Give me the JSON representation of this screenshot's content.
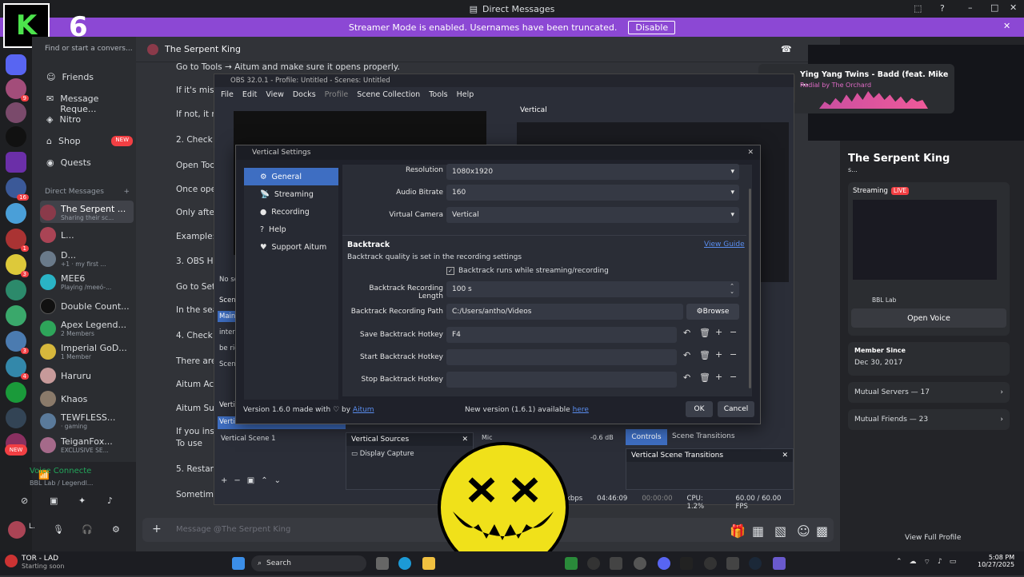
{
  "window": {
    "title": "Direct Messages"
  },
  "banner": {
    "text": "Streamer Mode is enabled. Usernames have been truncated.",
    "disable": "Disable"
  },
  "overlay": {
    "counter": "6"
  },
  "dm": {
    "search": "Find or start a convers...",
    "nav": [
      {
        "label": "Friends"
      },
      {
        "label": "Message Reque..."
      },
      {
        "label": "Nitro"
      },
      {
        "label": "Shop",
        "badge": "NEW"
      },
      {
        "label": "Quests"
      }
    ],
    "section": "Direct Messages",
    "items": [
      {
        "name": "The Serpent ...",
        "sub": "Sharing their sc..."
      },
      {
        "name": "L...",
        "sub": ""
      },
      {
        "name": "D...",
        "sub": "+1 · my first ..."
      },
      {
        "name": "MEE6",
        "sub": "Playing /meeó-..."
      },
      {
        "name": "Double Count...",
        "sub": ""
      },
      {
        "name": "Apex Legend...",
        "sub": "2 Members"
      },
      {
        "name": "Imperial GoD...",
        "sub": "1 Member"
      },
      {
        "name": "Haruru",
        "sub": ""
      },
      {
        "name": "Khaos",
        "sub": ""
      },
      {
        "name": "TEWFLESS...",
        "sub": "· gaming"
      },
      {
        "name": "TeiganFox...",
        "sub": "EXCLUSIVE SE..."
      }
    ],
    "voice": {
      "title": "Voice Connecte",
      "sub": "BBL Lab / Legendl..."
    },
    "user": {
      "name": "L."
    }
  },
  "chat": {
    "header": "The Serpent King",
    "placeholder": "Message @The Serpent King",
    "lines": [
      "Go to Tools → Aitum and make sure it opens properly.",
      "If it's missi",
      "If not, it mi",
      "2. Check th",
      "Open Tools",
      "Once open",
      "Only after",
      "Example: Y",
      "3. OBS Ho",
      "Go to Sett",
      "In the sear",
      "4. Check th",
      "There are",
      "Aitum Acti",
      "Aitum Suit",
      "If you insta",
      "To use",
      "5. Restart",
      "Sometime"
    ]
  },
  "obs": {
    "title": "OBS 32.0.1 - Profile: Untitled - Scenes: Untitled",
    "menu": [
      "File",
      "Edit",
      "View",
      "Docks",
      "Profile",
      "Scene Collection",
      "Tools",
      "Help"
    ],
    "vertical": "Vertical",
    "no_source": "No so",
    "scene_item": "Vertical Scene 1",
    "sources_title": "Vertical Sources",
    "source": "Display Capture",
    "mixer": {
      "label": "Mic",
      "db": "-0.6 dB"
    },
    "controls": "Controls",
    "scene_transitions": "Scene Transitions",
    "vst": "Vertical Scene Transitions",
    "status": {
      "kbps": "kbps",
      "time": "04:46:09",
      "rec": "00:00:00",
      "cpu": "CPU: 1.2%",
      "fps": "60.00 / 60.00 FPS"
    },
    "scn_head": "Scene",
    "main": "Main",
    "inte": "inter",
    "beri": "be rig",
    "scen": "Scen",
    "vert": "Verti",
    "vert2": "Verti"
  },
  "settings": {
    "title": "Vertical Settings",
    "nav": [
      {
        "label": "General",
        "icon": "⚙"
      },
      {
        "label": "Streaming",
        "icon": "📡"
      },
      {
        "label": "Recording",
        "icon": "●"
      },
      {
        "label": "Help",
        "icon": "?"
      },
      {
        "label": "Support Aitum",
        "icon": "♥"
      }
    ],
    "resolution": {
      "label": "Resolution",
      "value": "1080x1920"
    },
    "audio": {
      "label": "Audio Bitrate",
      "value": "160"
    },
    "vcam": {
      "label": "Virtual Camera",
      "value": "Vertical"
    },
    "backtrack": {
      "title": "Backtrack",
      "guide": "View Guide",
      "desc": "Backtrack quality is set in the recording settings",
      "checkbox": "Backtrack runs while streaming/recording",
      "length_label": "Backtrack Recording Length",
      "length": "100 s",
      "path_label": "Backtrack Recording Path",
      "path": "C:/Users/antho/Videos",
      "browse": "Browse",
      "save_label": "Save Backtrack Hotkey",
      "save": "F4",
      "start_label": "Start Backtrack Hotkey",
      "stop_label": "Stop Backtrack Hotkey"
    },
    "footer": {
      "version": "Version 1.6.0 made with ♡ by",
      "aitum": "Aitum",
      "newver": "New version (1.6.1) available",
      "here": "here",
      "ok": "OK",
      "cancel": "Cancel"
    }
  },
  "popup": {
    "song": "Ying Yang Twins - Badd (feat. Mike ...",
    "artist": "Radial by The Orchard"
  },
  "profile": {
    "name": "The Serpent King",
    "tag": "s...",
    "streaming": "Streaming",
    "live": "LIVE",
    "lab": "BBL Lab",
    "open_voice": "Open Voice",
    "member_label": "Member Since",
    "member": "Dec 30, 2017",
    "servers": "Mutual Servers — 17",
    "friends": "Mutual Friends — 23",
    "view": "View Full Profile"
  },
  "taskbar": {
    "weather_title": "TOR - LAD",
    "weather_sub": "Starting soon",
    "search": "Search",
    "time": "5:08 PM",
    "date": "10/27/2025"
  },
  "colors": {
    "accent": "#8c48d4",
    "live": "#f23f43",
    "obsblue": "#3e6ec2",
    "sticker": "#f0e11a"
  }
}
